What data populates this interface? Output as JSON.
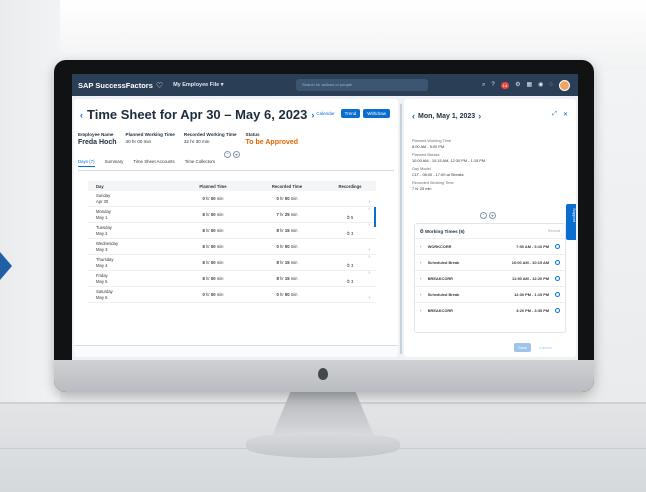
{
  "shell": {
    "brand": "SAP SuccessFactors",
    "menu": "My Employee File ▾",
    "search_placeholder": "Search for actions or people",
    "notification_count": "14"
  },
  "header": {
    "title": "Time Sheet for Apr 30 – May 6, 2023",
    "calendar_label": "Calendar",
    "trend_label": "Trend",
    "withdraw_label": "Withdraw"
  },
  "summary": {
    "employee_label": "Employee Name",
    "employee_value": "Freda Hoch",
    "planned_label": "Planned Working Time",
    "planned_value": "40 hr 00 min",
    "recorded_label": "Recorded Working Time",
    "recorded_value": "32 hr 30 min",
    "status_label": "Status",
    "status_value": "To be Approved"
  },
  "tabs": [
    {
      "label": "Days (7)"
    },
    {
      "label": "Summary"
    },
    {
      "label": "Time Sheet Accounts"
    },
    {
      "label": "Time Collectors"
    }
  ],
  "table": {
    "headers": {
      "day": "Day",
      "planned": "Planned Time",
      "recorded": "Recorded Time",
      "recordings": "Recordings"
    },
    "rows": [
      {
        "day": "Sunday",
        "date": "Apr 30",
        "planned_h": "0",
        "planned_m": "00",
        "recorded_h": "0",
        "recorded_m": "00",
        "count": ""
      },
      {
        "day": "Monday",
        "date": "May 1",
        "planned_h": "8",
        "planned_m": "00",
        "recorded_h": "7",
        "recorded_m": "25",
        "count": "5"
      },
      {
        "day": "Tuesday",
        "date": "May 2",
        "planned_h": "8",
        "planned_m": "00",
        "recorded_h": "8",
        "recorded_m": "15",
        "count": "3"
      },
      {
        "day": "Wednesday",
        "date": "May 3",
        "planned_h": "8",
        "planned_m": "00",
        "recorded_h": "0",
        "recorded_m": "00",
        "count": ""
      },
      {
        "day": "Thursday",
        "date": "May 4",
        "planned_h": "8",
        "planned_m": "00",
        "recorded_h": "8",
        "recorded_m": "15",
        "count": "3"
      },
      {
        "day": "Friday",
        "date": "May 5",
        "planned_h": "8",
        "planned_m": "00",
        "recorded_h": "8",
        "recorded_m": "15",
        "count": "3"
      },
      {
        "day": "Saturday",
        "date": "May 6",
        "planned_h": "0",
        "planned_m": "00",
        "recorded_h": "0",
        "recorded_m": "00",
        "count": ""
      }
    ],
    "hr_unit": "hr",
    "min_unit": "min"
  },
  "detail": {
    "title": "Mon, May 1, 2023",
    "planned_time_label": "Planned Working Time",
    "planned_time_value": "8:00 AM - 5:00 PM",
    "planned_breaks_label": "Planned Breaks",
    "planned_breaks_value": "10:00 AM - 10:15 AM, 12:30 PM - 1:15 PM",
    "day_model_label": "Day Model",
    "day_model_value": "CLT - 08:00 - 17:00 w/ Breaks",
    "recorded_label": "Recorded Working Time",
    "recorded_value": "7 hr 25 min",
    "working_times_title": "Working Times (5)",
    "record_label": "Record",
    "entries": [
      {
        "type": "WORKCORR",
        "time": "7:50 AM - 5:10 PM"
      },
      {
        "type": "Scheduled Break",
        "time": "10:00 AM - 10:15 AM"
      },
      {
        "type": "BREAKCORR",
        "time": "11:50 AM - 12:20 PM"
      },
      {
        "type": "Scheduled Break",
        "time": "12:30 PM - 1:15 PM"
      },
      {
        "type": "BREAKCORR",
        "time": "3:20 PM - 3:35 PM"
      }
    ],
    "save_label": "Save",
    "cancel_label": "Cancel",
    "support_label": "Support"
  }
}
